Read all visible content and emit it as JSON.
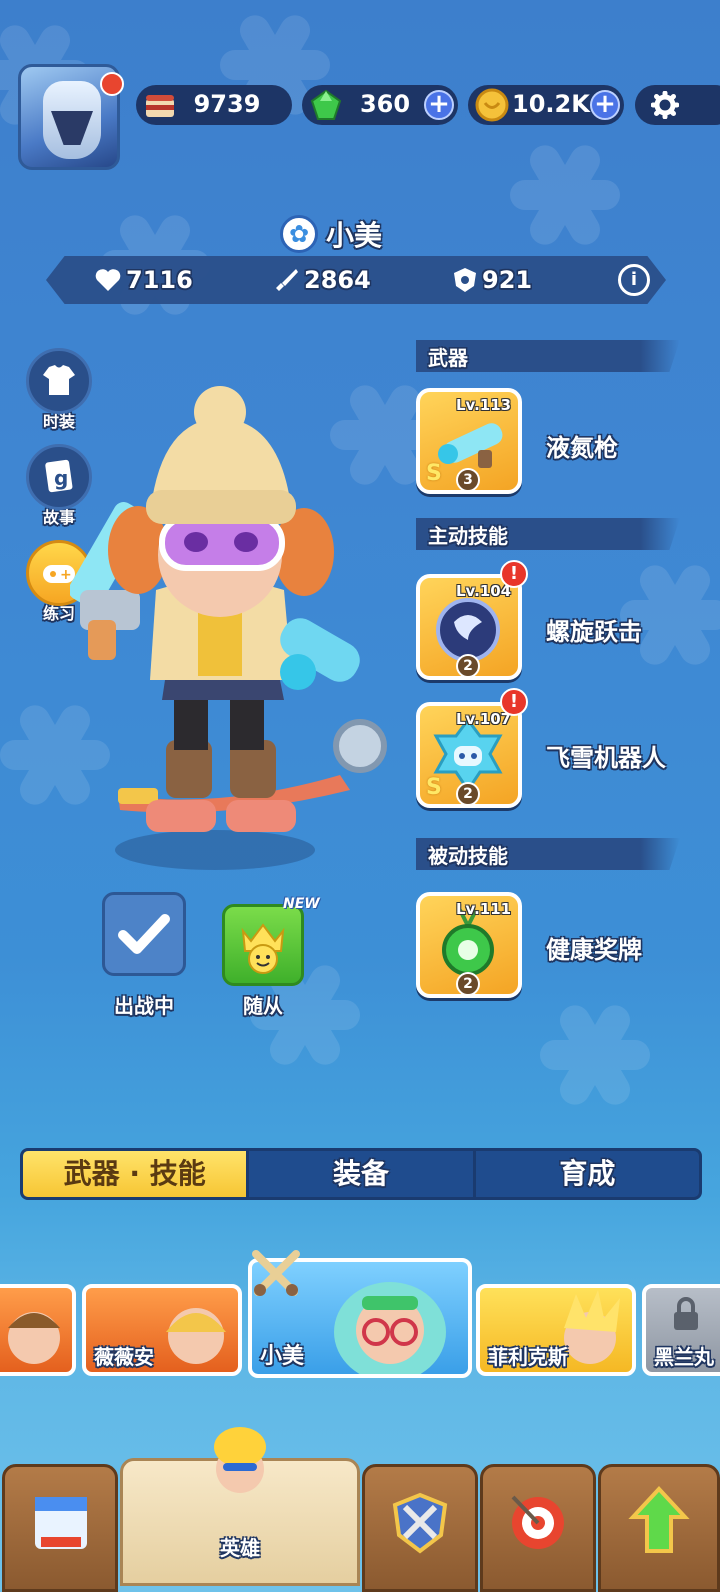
{
  "resources": {
    "cake": "9739",
    "gems": "360",
    "coins": "10.2K"
  },
  "hero": {
    "name": "小美",
    "hp": "7116",
    "attack": "2864",
    "defense": "921"
  },
  "side_buttons": {
    "costume": "时装",
    "story": "故事",
    "practice": "练习"
  },
  "sections": {
    "weapon": {
      "title": "武器",
      "items": [
        {
          "level": "Lv.113",
          "tier": "3",
          "name": "液氮枪"
        }
      ]
    },
    "active": {
      "title": "主动技能",
      "items": [
        {
          "level": "Lv.104",
          "tier": "2",
          "name": "螺旋跃击"
        },
        {
          "level": "Lv.107",
          "tier": "2",
          "name": "飞雪机器人"
        }
      ]
    },
    "passive": {
      "title": "被动技能",
      "items": [
        {
          "level": "Lv.111",
          "tier": "2",
          "name": "健康奖牌"
        }
      ]
    }
  },
  "deploy_label": "出战中",
  "follower": {
    "label": "随从",
    "badge": "NEW"
  },
  "tabs": [
    "武器 · 技能",
    "装备",
    "育成"
  ],
  "heroes": [
    "薇薇安",
    "小美",
    "菲利克斯",
    "黑兰丸"
  ],
  "nav": {
    "hero_label": "英雄"
  },
  "colors": {
    "background": "#3d86d2",
    "panel": "#2a4f8a",
    "accent_yellow": "#f7c634",
    "card_gold": "#f4a424"
  }
}
